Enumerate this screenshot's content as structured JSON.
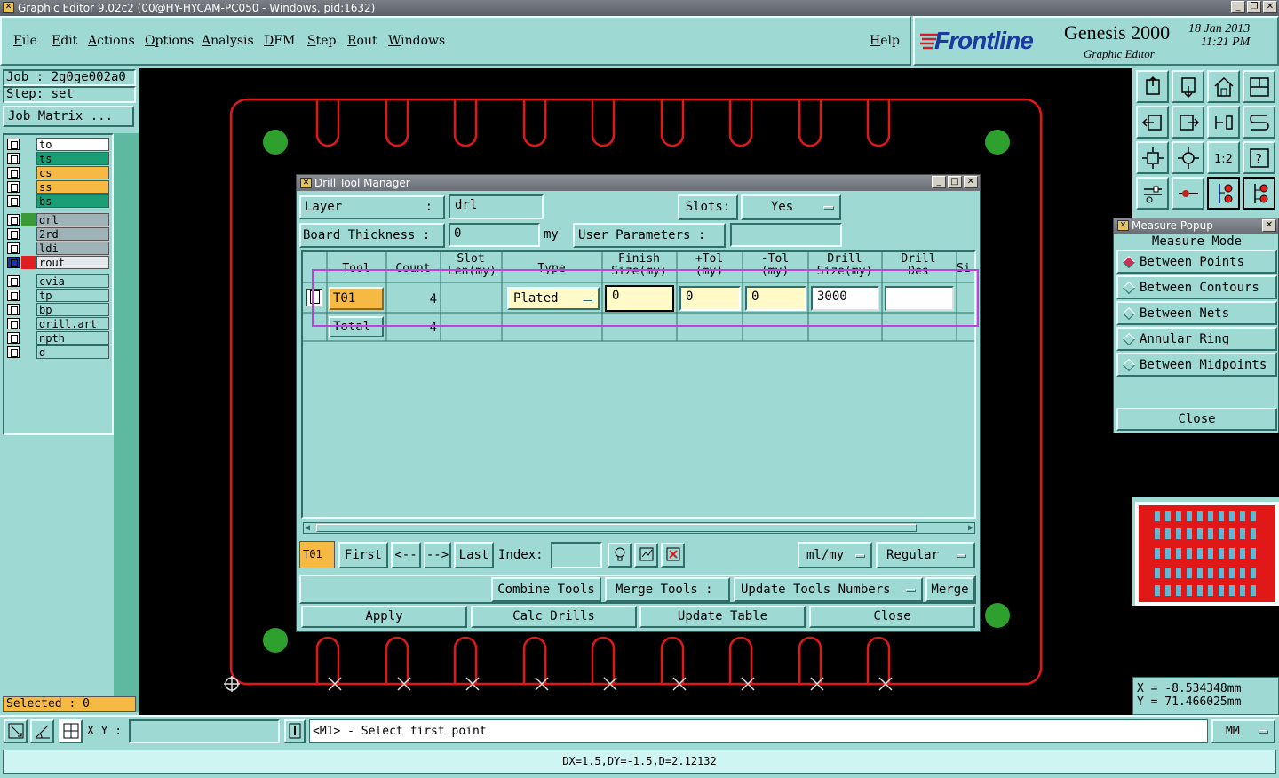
{
  "window": {
    "title": "Graphic Editor 9.02c2 (00@HY-HYCAM-PC050 - Windows, pid:1632)"
  },
  "menu": [
    "File",
    "Edit",
    "Actions",
    "Options",
    "Analysis",
    "DFM",
    "Step",
    "Rout",
    "Windows"
  ],
  "help": "Help",
  "brand": {
    "logo": "Frontline",
    "product": "Genesis 2000",
    "subtitle": "Graphic Editor",
    "date": "18 Jan 2013",
    "time": "11:21 PM"
  },
  "job": {
    "job": "Job : 2g0ge002a0",
    "step": "Step: set",
    "matrix_button": "Job Matrix ..."
  },
  "layers": [
    {
      "name": "to",
      "color": "#ffffff",
      "active": false
    },
    {
      "name": "ts",
      "color": "#1a9e76",
      "active": false
    },
    {
      "name": "cs",
      "color": "#f5b944",
      "active": false
    },
    {
      "name": "ss",
      "color": "#f5b944",
      "active": false
    },
    {
      "name": "bs",
      "color": "#1a9e76",
      "active": false
    },
    {
      "name": "drl",
      "color": "#9fb2b8",
      "active": false,
      "swatch": "#3a9a3a"
    },
    {
      "name": "2rd",
      "color": "#9fb2b8",
      "active": false
    },
    {
      "name": "ldi",
      "color": "#9fb2b8",
      "active": false
    },
    {
      "name": "rout",
      "color": "#e4e8ea",
      "active": true,
      "swatch": "#e02020"
    },
    {
      "name": "cvia",
      "color": "#9fd9d4",
      "active": false
    },
    {
      "name": "tp",
      "color": "#9fd9d4",
      "active": false
    },
    {
      "name": "bp",
      "color": "#9fd9d4",
      "active": false
    },
    {
      "name": "drill.art",
      "color": "#9fd9d4",
      "active": false
    },
    {
      "name": "npth",
      "color": "#9fd9d4",
      "active": false
    },
    {
      "name": "d",
      "color": "#9fd9d4",
      "active": false
    }
  ],
  "selected": "Selected : 0",
  "dialog": {
    "title": "Drill Tool Manager",
    "layer_label": "Layer",
    "layer_colon": ":",
    "layer_value": "drl",
    "slots_label": "Slots:",
    "slots_value": "Yes",
    "board_thickness_label": "Board Thickness :",
    "board_thickness_value": "0",
    "board_thickness_unit": "my",
    "user_params_label": "User Parameters :",
    "columns": [
      "Tool",
      "Count",
      "Slot Len(my)",
      "Type",
      "Finish Size(my)",
      "+Tol (my)",
      "-Tol (my)",
      "Drill Size(my)",
      "Drill Des",
      "Si"
    ],
    "rows": [
      {
        "tool": "T01",
        "count": "4",
        "type": "Plated",
        "finish": "0",
        "plus_tol": "0",
        "minus_tol": "0",
        "drill_size": "3000",
        "drill_des": ""
      }
    ],
    "total": {
      "label": "Total",
      "count": "4"
    },
    "nav": {
      "current": "T01",
      "first": "First",
      "prev": "<--",
      "next": "-->",
      "last": "Last",
      "index_label": "Index:",
      "units": "ml/my",
      "mode": "Regular"
    },
    "actions": {
      "combine": "Combine Tools",
      "merge_label": "Merge Tools :",
      "merge_option": "Update Tools Numbers",
      "merge": "Merge"
    },
    "bottom": {
      "apply": "Apply",
      "calc": "Calc Drills",
      "update": "Update Table",
      "close": "Close"
    }
  },
  "measure": {
    "title": "Measure Popup",
    "mode_label": "Measure Mode",
    "options": [
      "Between Points",
      "Between Contours",
      "Between Nets",
      "Annular Ring",
      "Between Midpoints"
    ],
    "selected_index": 0,
    "close": "Close"
  },
  "coords": {
    "x": "X = -8.534348mm",
    "y": "Y = 71.466025mm"
  },
  "statusbar": {
    "xy_label": "X Y :",
    "prompt": "<M1> - Select first point",
    "units": "MM",
    "bottom": "DX=1.5,DY=-1.5,D=2.12132"
  },
  "colors": {
    "panel": "#9fd9d4",
    "board_outline": "#e01818",
    "pad": "#2ea02e",
    "highlight": "#c040e0"
  }
}
